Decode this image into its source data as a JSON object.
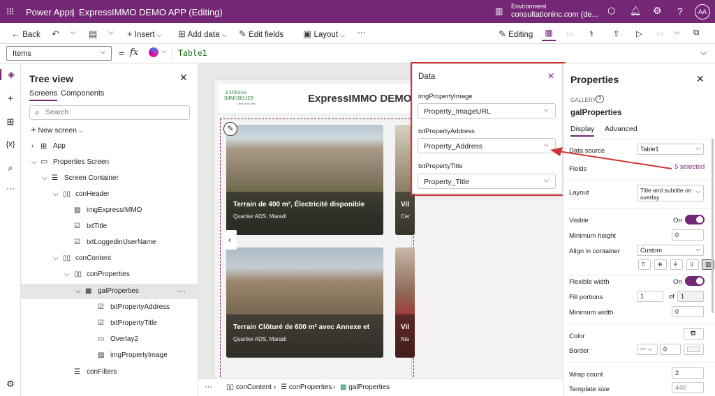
{
  "titlebar": {
    "app_name": "Power Apps",
    "separator": "|",
    "doc_title": "ExpressIMMO DEMO APP (Editing)",
    "env_label": "Environment",
    "env_name": "consultationinc.com (de...",
    "avatar": "AA",
    "help": "?"
  },
  "cmdbar": {
    "back": "Back",
    "insert": "Insert",
    "add_data": "Add data",
    "edit_fields": "Edit fields",
    "layout": "Layout",
    "more": "···",
    "editing": "Editing"
  },
  "formula": {
    "property": "Items",
    "equals": "=",
    "fx": "fx",
    "value": "Table1"
  },
  "tree": {
    "title": "Tree view",
    "tab_screens": "Screens",
    "tab_components": "Components",
    "search_placeholder": "Search",
    "new_screen": "New screen",
    "items": [
      {
        "label": "App"
      },
      {
        "label": "Properties Screen"
      },
      {
        "label": "Screen Container"
      },
      {
        "label": "conHeader"
      },
      {
        "label": "imgExpressIMMO"
      },
      {
        "label": "txtTitle"
      },
      {
        "label": "txtLoggedinUserName"
      },
      {
        "label": "conContent"
      },
      {
        "label": "conProperties"
      },
      {
        "label": "galProperties"
      },
      {
        "label": "txtPropertyAddress"
      },
      {
        "label": "txtPropertyTitle"
      },
      {
        "label": "Overlay2"
      },
      {
        "label": "imgPropertyImage"
      },
      {
        "label": "conFilters"
      }
    ],
    "row_more": "···"
  },
  "canvas": {
    "logo_line1": "EXPRESS",
    "logo_line2": "IMMOBILIER",
    "logo_tag": "Chez vous Hey",
    "header_title": "ExpressIMMO DEMO",
    "cards": [
      {
        "title": "Terrain de 400 m², Électricité disponible",
        "address": "Quartier ADS, Maradi"
      },
      {
        "title": "Vil",
        "address": "Cer"
      },
      {
        "title": "Terrain Clôturé de 600 m² avec Annexe  et",
        "address": "Quartier ADS, Maradi"
      },
      {
        "title": "Vil",
        "address": "Nia"
      }
    ]
  },
  "breadcrumb": {
    "more": "···",
    "items": [
      "conContent",
      "conProperties",
      "galProperties"
    ]
  },
  "data_flyout": {
    "title": "Data",
    "fields": [
      {
        "label": "imgPropertyImage",
        "value": "Property_ImageURL"
      },
      {
        "label": "txtPropertyAddress",
        "value": "Property_Address"
      },
      {
        "label": "txtPropertyTitle",
        "value": "Property_Title"
      }
    ]
  },
  "properties": {
    "title": "Properties",
    "type": "GALLERY",
    "name": "galProperties",
    "tab_display": "Display",
    "tab_advanced": "Advanced",
    "data_source_label": "Data source",
    "data_source_value": "Table1",
    "fields_label": "Fields",
    "fields_value": "5 selected",
    "layout_label": "Layout",
    "layout_value": "Title and subtitle on overlay",
    "visible_label": "Visible",
    "visible_value": "On",
    "min_height_label": "Minimum height",
    "min_height_value": "0",
    "align_label": "Align in container",
    "align_value": "Custom",
    "flex_width_label": "Flexible width",
    "flex_width_value": "On",
    "fill_portions_label": "Fill portions",
    "fill_portions_value": "1",
    "fill_of": "of",
    "fill_total": "1",
    "min_width_label": "Minimum width",
    "min_width_value": "0",
    "color_label": "Color",
    "border_label": "Border",
    "border_value": "0",
    "wrap_count_label": "Wrap count",
    "wrap_count_value": "2",
    "template_size_label": "Template size",
    "template_size_value": "440"
  },
  "colors": {
    "brand": "#742774",
    "highlight": "#d13438"
  }
}
